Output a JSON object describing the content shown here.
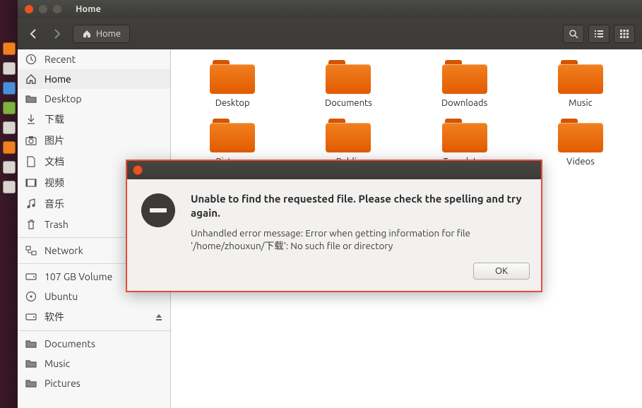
{
  "window": {
    "title": "Home"
  },
  "toolbar": {
    "path_label": "Home"
  },
  "sidebar": {
    "items": [
      {
        "label": "Recent"
      },
      {
        "label": "Home"
      },
      {
        "label": "Desktop"
      },
      {
        "label": "下载"
      },
      {
        "label": "图片"
      },
      {
        "label": "文档"
      },
      {
        "label": "视频"
      },
      {
        "label": "音乐"
      },
      {
        "label": "Trash"
      },
      {
        "label": "Network"
      },
      {
        "label": "107 GB Volume"
      },
      {
        "label": "Ubuntu"
      },
      {
        "label": "软件"
      },
      {
        "label": "Documents"
      },
      {
        "label": "Music"
      },
      {
        "label": "Pictures"
      }
    ]
  },
  "folders": [
    {
      "label": "Desktop"
    },
    {
      "label": "Documents"
    },
    {
      "label": "Downloads"
    },
    {
      "label": "Music"
    },
    {
      "label": "Pictures"
    },
    {
      "label": "Public"
    },
    {
      "label": "Templates"
    },
    {
      "label": "Videos"
    }
  ],
  "dialog": {
    "heading": "Unable to find the requested file. Please check the spelling and try again.",
    "message": "Unhandled error message: Error when getting information for file '/home/zhouxun/下载': No such file or directory",
    "ok_label": "OK"
  }
}
